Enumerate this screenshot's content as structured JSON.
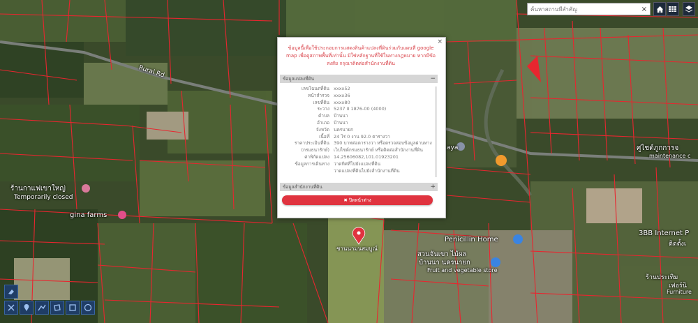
{
  "search": {
    "placeholder": "ค้นหาสถานที่สำคัญ",
    "clear_icon": "×"
  },
  "toolbar": {
    "home_icon": "home-icon",
    "grid_icon": "grid-icon",
    "layers_icon": "layers-icon"
  },
  "map_labels": {
    "road": "Rural Rd",
    "cafe_th": "ร้านกาแฟเขาใหญ่",
    "cafe_status": "Temporarily closed",
    "gina": "gina farms",
    "penicillin": "Penicillin Home",
    "orchard_th1": "สวนจันเขา ไม้ผล",
    "orchard_th2": "บ้านนา นครนายก",
    "orchard_en": "Fruit and vegetable store",
    "internet_top": "3BB Internet P",
    "internet_sub": "ติดตั้งเ",
    "shop_th": "ร้านประเทิม",
    "shop_th2": "เฟอร์นิ",
    "shop_en": "Furniture",
    "center_th": "ศูไชต์ภูกการจ",
    "maintenance": "maintenance c",
    "maya": "aya",
    "marker_label": "ชานนามนสมบูณ์"
  },
  "popup": {
    "close": "×",
    "notice": "ข้อมูลนี้เพื่อใช้ประกอบการแสดงสินค้าแปลงที่ดินร่วมกับแผนที่ google map เพื่อดูสภาพพื้นที่เท่านั้น มิใช่หลักฐานที่ใช้ในทางกฎหมาย หากมีข้อสงสัย กรุณาติดต่อสำนักงานที่ดิน",
    "section1": {
      "title": "ข้อมูลแปลงที่ดิน",
      "sign": "−"
    },
    "rows": [
      {
        "k": "เลขโฉนดที่ดิน",
        "v": "xxxx52"
      },
      {
        "k": "หน้าสำรวจ",
        "v": "xxxx36"
      },
      {
        "k": "เลขที่ดิน",
        "v": "xxxx80"
      },
      {
        "k": "ระวาง",
        "v": "5237 II 1876-00 (4000)"
      },
      {
        "k": "ตำบล",
        "v": "บ้านนา"
      },
      {
        "k": "อำเภอ",
        "v": "บ้านนา"
      },
      {
        "k": "จังหวัด",
        "v": "นครนายก"
      },
      {
        "k": "เนื้อที่",
        "v": "24 ไร่ 0 งาน 92.0 ตารางวา"
      },
      {
        "k": "ราคาประเมินที่ดิน",
        "v": "390 บาทต่อตารางวา หรือตรวจสอบข้อมูลผ่านทาง"
      },
      {
        "k": "(กรมธนารักษ์)",
        "v": "เว็บไซต์กรมธนารักษ์ หรือติดต่อสำนักงานที่ดิน"
      },
      {
        "k": "ค่าพิกัดแปลง",
        "v": "14.25606082,101.01923201"
      },
      {
        "k": "ข้อมูลการเดินทาง",
        "v": "วาดทิศที่ไปยังแปลงที่ดิน"
      },
      {
        "k": "",
        "v": "วาดแปลงที่ดินไปยังสำนักงานที่ดิน"
      }
    ],
    "section2": {
      "title": "ข้อมูลสำนักงานที่ดิน",
      "sign": "+"
    },
    "back_button": "✖ ปิดหน้าต่าง"
  },
  "colors": {
    "parcel_line": "#e8262f",
    "accent": "#e0333f",
    "tool_blue": "#1f3d66"
  }
}
